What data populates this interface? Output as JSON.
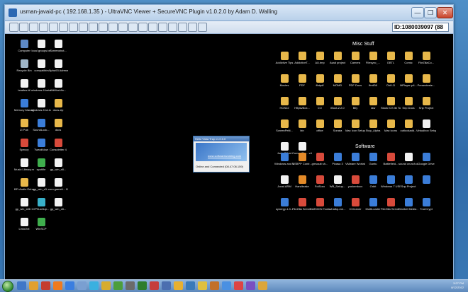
{
  "window": {
    "title": "usman-javaid-pc ( 192.168.1.35 ) - UltraVNC Viewer + SecureVNC Plugin v1.0.2.0 by Adam D. Walling",
    "min_label": "—",
    "max_label": "❐",
    "close_label": "✕",
    "id_field": "ID:1080039097 (88"
  },
  "toolbar": {
    "buttons": [
      "btn-1",
      "btn-2",
      "btn-3",
      "btn-4",
      "btn-5",
      "btn-6",
      "btn-7",
      "btn-8",
      "btn-9",
      "btn-10",
      "btn-11",
      "btn-12",
      "btn-13",
      "btn-14",
      "btn-15",
      "btn-16",
      "btn-17",
      "btn-18",
      "btn-19",
      "btn-20"
    ]
  },
  "left_icons": [
    {
      "label": "Computer",
      "kind": "pc"
    },
    {
      "label": "local groups.txt",
      "kind": "file"
    },
    {
      "label": "Screenshot...",
      "kind": "file"
    },
    {
      "label": "Recycle Bin",
      "kind": "bin"
    },
    {
      "label": "compatible",
      "kind": "file"
    },
    {
      "label": "Alpha93 Adrenaline...",
      "kind": "file"
    },
    {
      "label": "beatles.ttf",
      "kind": "file"
    },
    {
      "label": "windows 8 beta points.txt",
      "kind": "file"
    },
    {
      "label": "WiiWorkflo...",
      "kind": "file"
    },
    {
      "label": "Memory Manageme...",
      "kind": "app"
    },
    {
      "label": "windows 8 lol.txt",
      "kind": "file"
    },
    {
      "label": "docs.zip",
      "kind": "folder"
    },
    {
      "label": "ZI Pub",
      "kind": "folder"
    },
    {
      "label": "SoundLock...",
      "kind": "app"
    },
    {
      "label": "docs",
      "kind": "folder"
    },
    {
      "label": "Speccy",
      "kind": "red"
    },
    {
      "label": "TweakNow",
      "kind": "app"
    },
    {
      "label": "Consoletter 4",
      "kind": "red"
    },
    {
      "label": "Music Library.m3u",
      "kind": "file"
    },
    {
      "label": "spotifie",
      "kind": "green"
    },
    {
      "label": "gp_win_x8...",
      "kind": "file"
    },
    {
      "label": "BFt Audio Enhancer 3...",
      "kind": "folder"
    },
    {
      "label": "gp_win_x3...",
      "kind": "file"
    },
    {
      "label": "com.gameli... 02.apk",
      "kind": "file"
    },
    {
      "label": "gp_win_x86 1",
      "kind": "file"
    },
    {
      "label": "VPN-setup...",
      "kind": "cyan"
    },
    {
      "label": "gp_win_x8...",
      "kind": "file"
    },
    {
      "label": "Linkd.txt",
      "kind": "file"
    },
    {
      "label": "WinSCP",
      "kind": "green"
    }
  ],
  "misc": {
    "heading": "Misc Stuff",
    "icons": [
      {
        "label": "Addictive Tips",
        "kind": "folder"
      },
      {
        "label": "AddictiveT...",
        "kind": "folder"
      },
      {
        "label": "AU.tmp",
        "kind": "folder"
      },
      {
        "label": "Asad project",
        "kind": "folder"
      },
      {
        "label": "Camera",
        "kind": "folder"
      },
      {
        "label": "Filesync_...",
        "kind": "folder"
      },
      {
        "label": "GBTL",
        "kind": "folder"
      },
      {
        "label": "Comic",
        "kind": "folder"
      },
      {
        "label": "FileZillaCo...",
        "kind": "folder"
      },
      {
        "label": "Movies",
        "kind": "folder"
      },
      {
        "label": "PDF",
        "kind": "folder"
      },
      {
        "label": "ffotpdf",
        "kind": "folder"
      },
      {
        "label": "MOMD",
        "kind": "folder"
      },
      {
        "label": "PDF Docs",
        "kind": "folder"
      },
      {
        "label": "ffmil36",
        "kind": "folder"
      },
      {
        "label": "Old LD",
        "kind": "folder"
      },
      {
        "label": "MPlayer-p4...",
        "kind": "folder"
      },
      {
        "label": "Presenteste...",
        "kind": "folder"
      },
      {
        "label": "HOS22",
        "kind": "folder"
      },
      {
        "label": "HttpsvBox...",
        "kind": "folder"
      },
      {
        "label": "0.0",
        "kind": "folder"
      },
      {
        "label": "iBoot-2.2.0",
        "kind": "folder"
      },
      {
        "label": "Blly",
        "kind": "folder"
      },
      {
        "label": "raw",
        "kind": "folder"
      },
      {
        "label": "Stock ICS lib Tools",
        "kind": "folder"
      },
      {
        "label": "Snp Docs",
        "kind": "folder"
      },
      {
        "label": "Snp Project",
        "kind": "folder"
      },
      {
        "label": "ScreenPelti...",
        "kind": "folder"
      },
      {
        "label": "bin",
        "kind": "folder"
      },
      {
        "label": "office",
        "kind": "folder"
      },
      {
        "label": "Sonata",
        "kind": "folder"
      },
      {
        "label": "Mac Icon Setup",
        "kind": "folder"
      },
      {
        "label": "Stop_Alpha",
        "kind": "folder"
      },
      {
        "label": "Mac icons",
        "kind": "folder"
      },
      {
        "label": "outlookadd...",
        "kind": "folder"
      },
      {
        "label": "Virtualbox Setup",
        "kind": "file"
      },
      {
        "label": "Junk Off.txt",
        "kind": "file"
      },
      {
        "label": "ConvertDo... v4.0.0.22",
        "kind": "file"
      }
    ]
  },
  "software": {
    "heading": "Software",
    "icons": [
      {
        "label": "Windows and Windi...",
        "kind": "app"
      },
      {
        "label": "USBPP Contr...",
        "kind": "orange"
      },
      {
        "label": "gmvault sh...",
        "kind": "red"
      },
      {
        "label": "Picasa 3",
        "kind": "app"
      },
      {
        "label": "VMware Workstation",
        "kind": "app"
      },
      {
        "label": "Gantu",
        "kind": "app"
      },
      {
        "label": "Battlefield...",
        "kind": "red"
      },
      {
        "label": "sound crunch.docx",
        "kind": "file"
      },
      {
        "label": "Google Drive",
        "kind": "app"
      },
      {
        "label": "Jonal.ARM",
        "kind": "file"
      },
      {
        "label": "Handbrake",
        "kind": "orange"
      },
      {
        "label": "FotSoro",
        "kind": "red"
      },
      {
        "label": "WB_Setup...",
        "kind": "file"
      },
      {
        "label": "yonkerdocx",
        "kind": "red"
      },
      {
        "label": "Orbit",
        "kind": "app"
      },
      {
        "label": "Windows 7 USB DVD...",
        "kind": "app"
      },
      {
        "label": "Snp Project",
        "kind": "app"
      },
      {
        "label": "",
        "kind": "app"
      },
      {
        "label": "synergy-1.3...",
        "kind": "app"
      },
      {
        "label": "FileZilla Server ...",
        "kind": "red"
      },
      {
        "label": "DAEMON Tools Lite",
        "kind": "red"
      },
      {
        "label": "whatkp-me...",
        "kind": "app"
      },
      {
        "label": "CCleaner",
        "kind": "red"
      },
      {
        "label": "MultiLoader",
        "kind": "app"
      },
      {
        "label": "FileZilla Server ...",
        "kind": "red"
      },
      {
        "label": "Decibel Media ...",
        "kind": "app"
      },
      {
        "label": "TrueCrypt",
        "kind": "app"
      }
    ]
  },
  "popup": {
    "title": "Hello Vista Tray v1.0.0.0",
    "link": "www.softwareworking.com",
    "status": "Online and Connected (08.47.06.159)"
  },
  "taskbar": {
    "time": "3:27 PM",
    "date": "8/12/2012",
    "items": [
      "#3f77c7",
      "#e0a030",
      "#c43c2e",
      "#ef7a1f",
      "#3a7ee0",
      "#7a9fd1",
      "#3ab0e0",
      "#d7ac2e",
      "#4c9e3b",
      "#6b6b6b",
      "#2d7d2d",
      "#c53d3d",
      "#4c6fb0",
      "#e8b030",
      "#3a7ab9",
      "#e0c040",
      "#c2702a",
      "#4a90e2",
      "#d44",
      "#7a4fc1",
      "#dca63b"
    ]
  }
}
